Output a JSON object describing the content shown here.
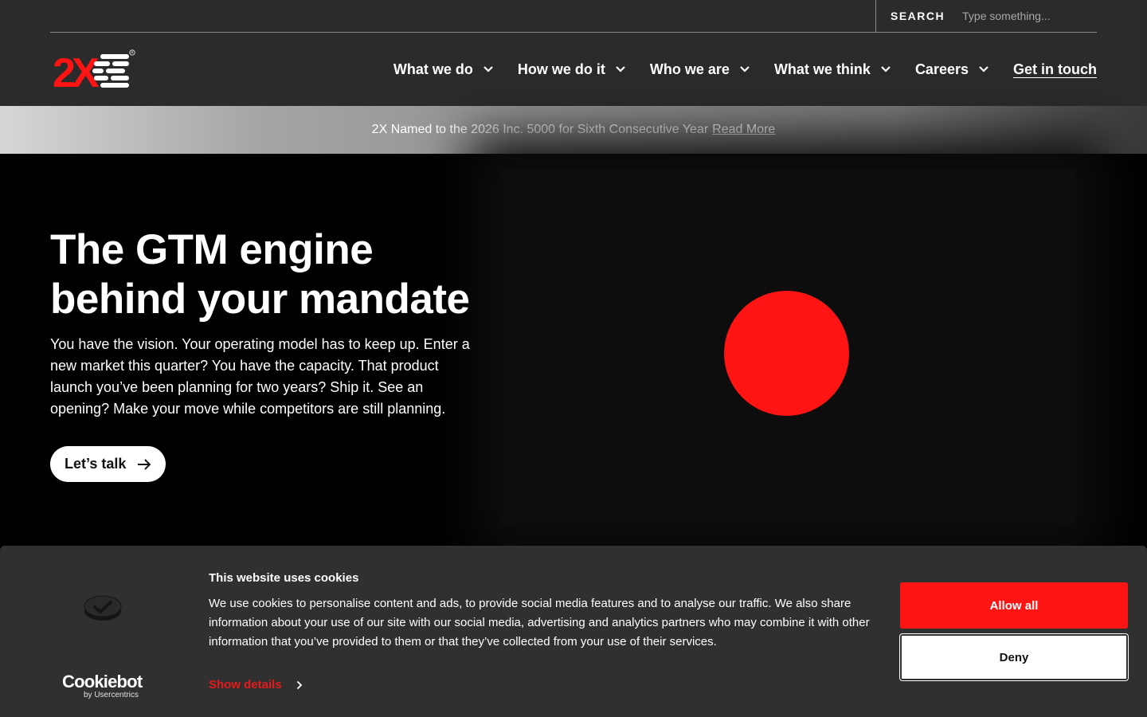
{
  "header": {
    "search_label": "SEARCH",
    "search_placeholder": "Type something...",
    "logo_text": "2X",
    "nav": [
      {
        "label": "What we do"
      },
      {
        "label": "How we do it"
      },
      {
        "label": "Who we are"
      },
      {
        "label": "What we think"
      },
      {
        "label": "Careers"
      }
    ],
    "cta": "Get in touch"
  },
  "announcement": {
    "text": "2X Named to the 2026 Inc. 5000 for Sixth Consecutive Year",
    "link": "Read More"
  },
  "hero": {
    "title_line1": "The GTM engine",
    "title_line2": "behind your mandate",
    "body": "You have the vision. Your operating model has to keep up. Enter a new market this quarter? You have the capacity. That product launch you’ve been planning for two years? Ship it. See an opening? Make your move while competitors are still planning.",
    "cta": "Let’s talk"
  },
  "cookie": {
    "title": "This website uses cookies",
    "text": "We use cookies to personalise content and ads, to provide social media features and to analyse our traffic. We also share information about your use of our site with our social media, advertising and analytics partners who may combine it with other information that you’ve provided to them or that they’ve collected from your use of their services.",
    "show_details": "Show details",
    "allow": "Allow all",
    "deny": "Deny",
    "brand": "Cookiebot",
    "brand_sub": "by Usercentrics"
  },
  "colors": {
    "accent_red": "#ff1414",
    "header_bg": "#2b2b2b",
    "banner_bg": "#303030"
  }
}
